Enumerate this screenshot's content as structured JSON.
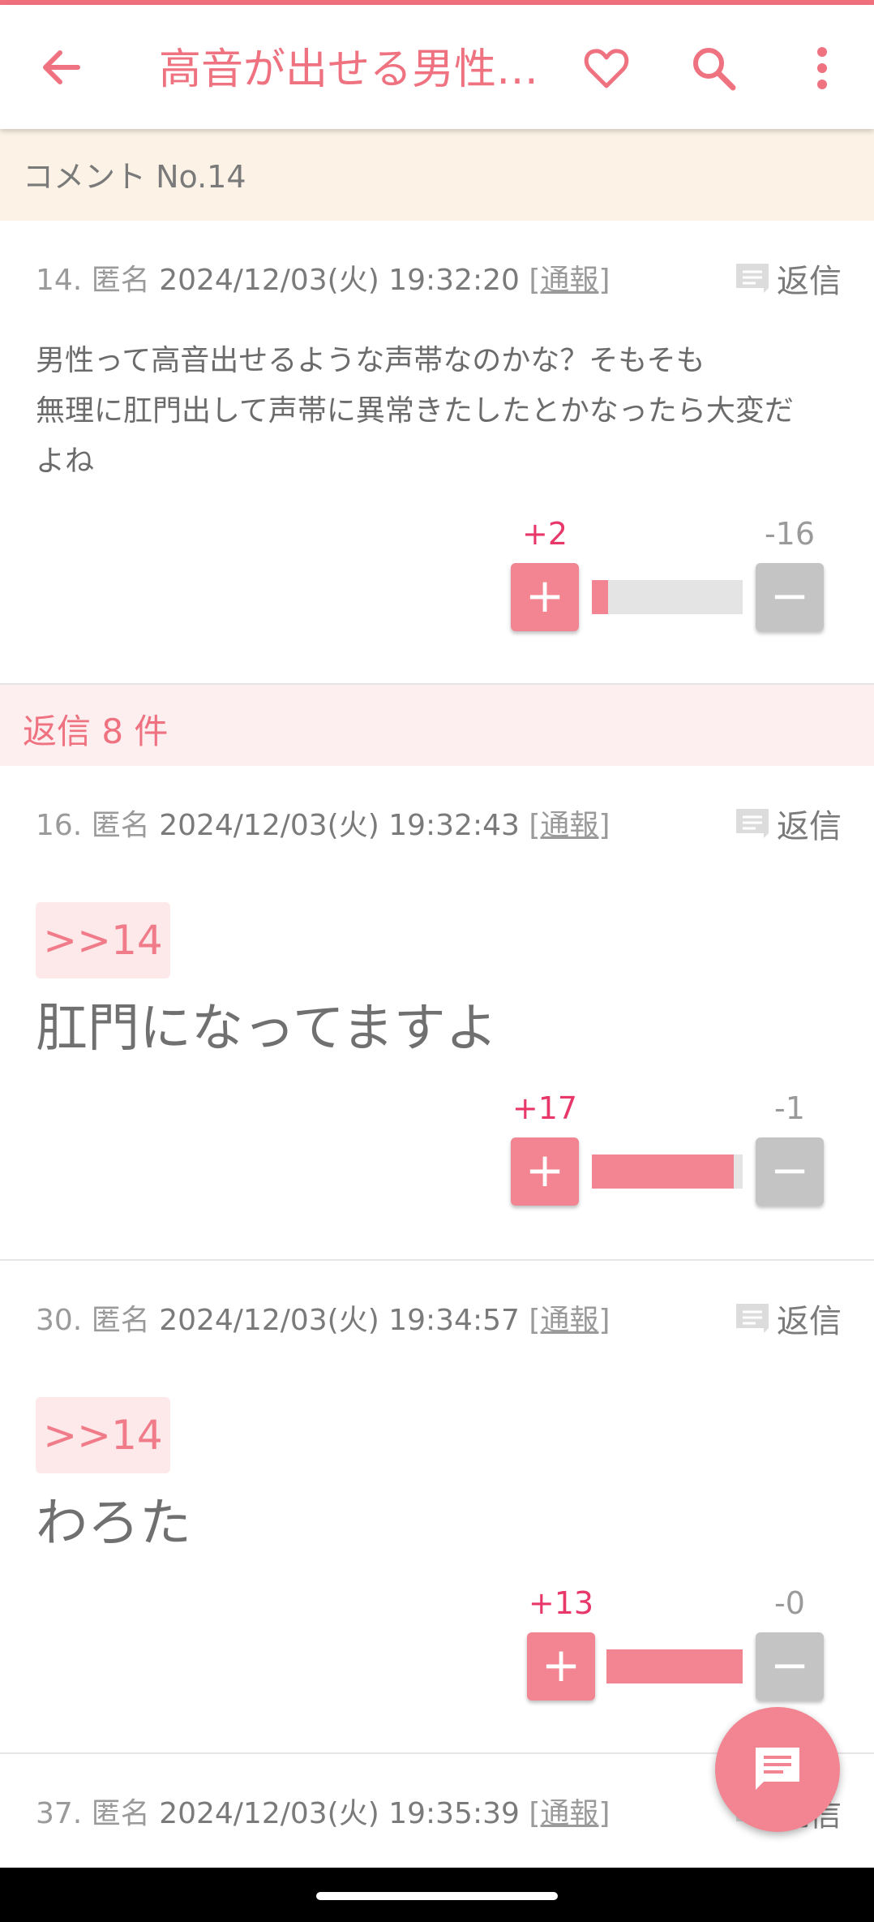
{
  "app_bar": {
    "title": "高音が出せる男性…",
    "back_icon": "arrow-left-icon",
    "favorite_icon": "heart-outline-icon",
    "search_icon": "search-icon",
    "more_icon": "more-vertical-icon",
    "accent_color": "#ef7280"
  },
  "comment_header": "コメント No.14",
  "main_post": {
    "number": "14.",
    "author": "匿名",
    "datetime": "2024/12/03(火) 19:32:20",
    "report": "[通報]",
    "reply": "返信",
    "body_line1": "男性って高音出せるような声帯なのかな？そもそも",
    "body_line2": "無理に肛門出して声帯に異常きたしたとかなったら大変だ",
    "body_line3": "よね",
    "plus": "+2",
    "minus": "-16",
    "plus_fraction": 0.11
  },
  "replies_label": "返信 8 件",
  "replies": [
    {
      "number": "16.",
      "author": "匿名",
      "datetime": "2024/12/03(火) 19:32:43",
      "report": "[通報]",
      "reply": "返信",
      "quote": ">>14",
      "body": "肛門になってますよ",
      "plus": "+17",
      "minus": "-1",
      "plus_fraction": 0.94
    },
    {
      "number": "30.",
      "author": "匿名",
      "datetime": "2024/12/03(火) 19:34:57",
      "report": "[通報]",
      "reply": "返信",
      "quote": ">>14",
      "body": "わろた",
      "plus": "+13",
      "minus": "-0",
      "plus_fraction": 1.0
    },
    {
      "number": "37.",
      "author": "匿名",
      "datetime": "2024/12/03(火) 19:35:39",
      "report": "[通報]",
      "reply": "返信"
    }
  ],
  "fab_icon": "comment-icon",
  "colors": {
    "accent": "#ef7280",
    "plus_count": "#e8386a",
    "vote_plus": "#f28591",
    "vote_minus": "#c4c4c4",
    "header_bg": "#fcf3e6",
    "replies_bg": "#fdeef0"
  }
}
